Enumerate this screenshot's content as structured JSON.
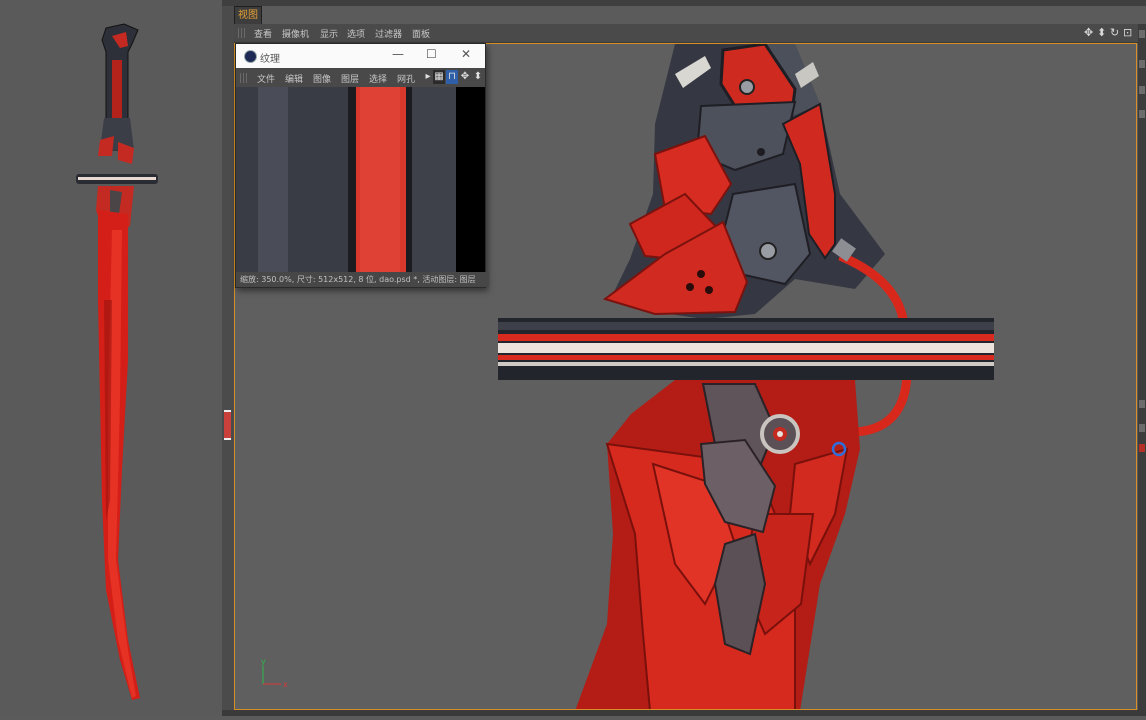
{
  "viewport": {
    "tab_label": "视图",
    "menu": [
      "查看",
      "摄像机",
      "显示",
      "选项",
      "过滤器",
      "面板"
    ],
    "nav_icons": [
      "move-icon",
      "zoom-icon",
      "rotate-icon",
      "maximize-icon"
    ],
    "axis_labels": {
      "y": "y",
      "x": "x"
    },
    "accent_color": "#d88f25"
  },
  "texture_window": {
    "title": "纹理",
    "window_controls": [
      "—",
      "☐",
      "✕"
    ],
    "menu": [
      "文件",
      "编辑",
      "图像",
      "图层",
      "选择",
      "网孔"
    ],
    "status": "缩放: 350.0%, 尺寸: 512x512, 8 位, dao.psd *, 活动图层: 图层"
  },
  "colors": {
    "blade_red": "#d9261c",
    "dark_metal": "#3a3d46",
    "ui_background": "#5f5f5f"
  }
}
